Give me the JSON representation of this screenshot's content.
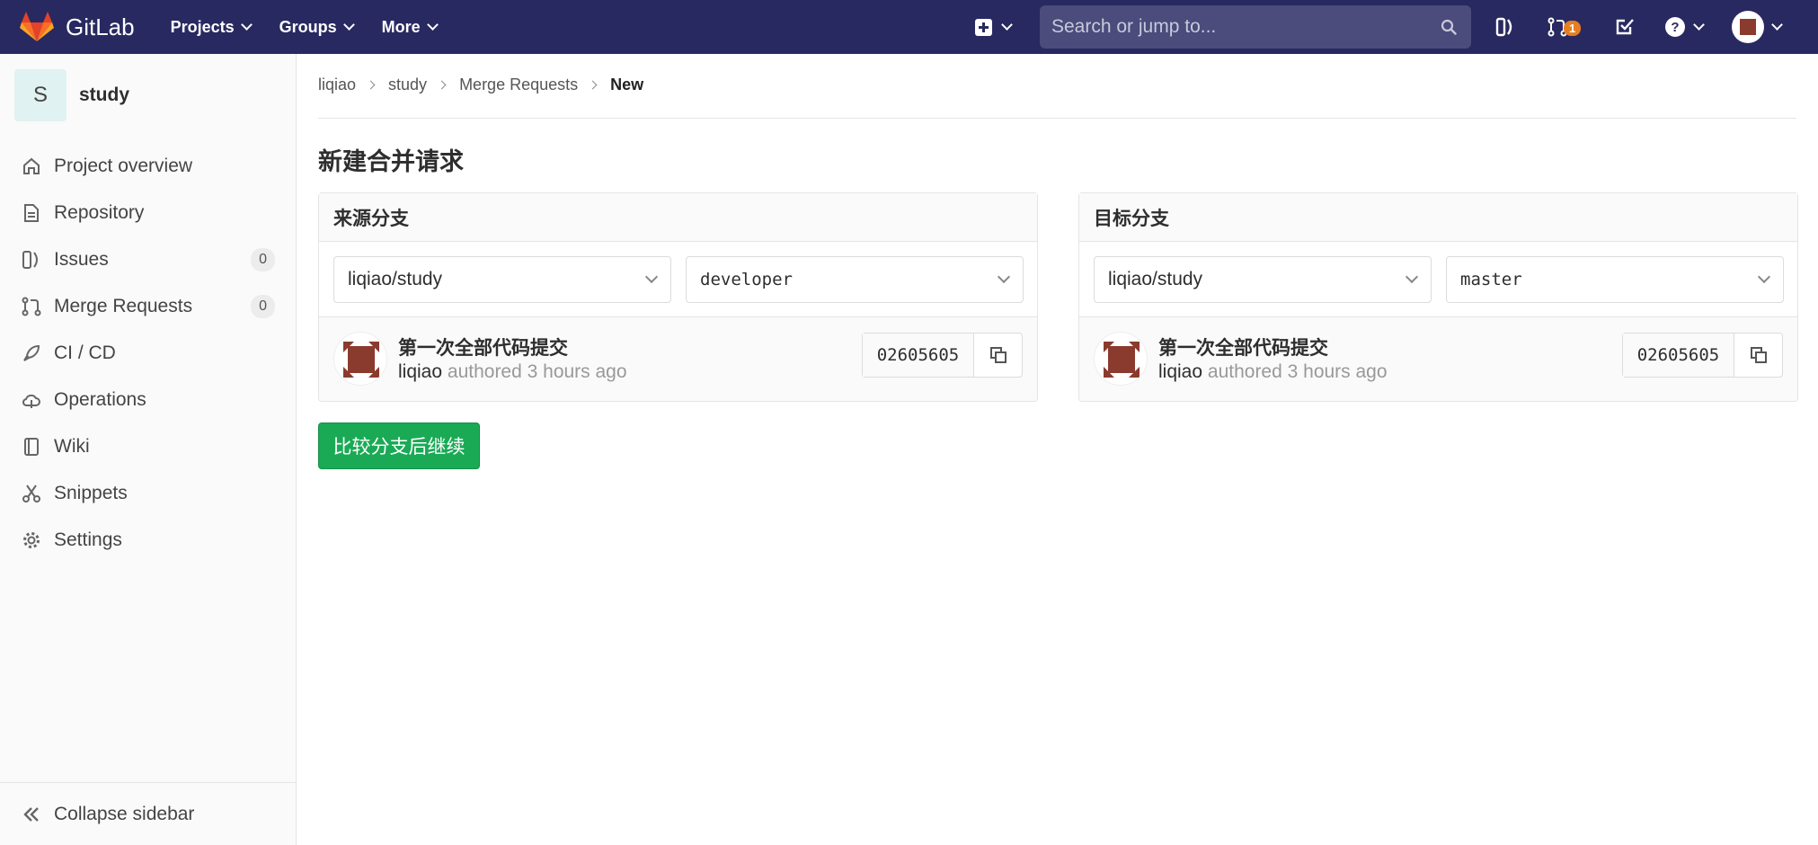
{
  "app": {
    "name": "GitLab",
    "colors": {
      "navbar": "#292961",
      "accent": "#1aaa55",
      "badge": "#e67e22"
    }
  },
  "navbar": {
    "menus": [
      "Projects",
      "Groups",
      "More"
    ],
    "search_placeholder": "Search or jump to...",
    "merge_request_badge": "1",
    "icons": [
      "plus-square-icon",
      "search-icon",
      "issues-icon",
      "merge-request-icon",
      "todo-icon",
      "help-icon",
      "user-avatar"
    ]
  },
  "sidebar": {
    "project_initial": "S",
    "project_name": "study",
    "items": [
      {
        "label": "Project overview",
        "icon": "home-icon"
      },
      {
        "label": "Repository",
        "icon": "document-icon"
      },
      {
        "label": "Issues",
        "icon": "issues-icon",
        "count": "0"
      },
      {
        "label": "Merge Requests",
        "icon": "merge-request-icon",
        "count": "0"
      },
      {
        "label": "CI / CD",
        "icon": "rocket-icon"
      },
      {
        "label": "Operations",
        "icon": "cloud-icon"
      },
      {
        "label": "Wiki",
        "icon": "book-icon"
      },
      {
        "label": "Snippets",
        "icon": "scissors-icon"
      },
      {
        "label": "Settings",
        "icon": "gear-icon"
      }
    ],
    "collapse_label": "Collapse sidebar"
  },
  "breadcrumb": [
    "liqiao",
    "study",
    "Merge Requests",
    "New"
  ],
  "page": {
    "title": "新建合并请求",
    "source": {
      "heading": "来源分支",
      "project": "liqiao/study",
      "branch": "developer",
      "commit_title": "第一次全部代码提交",
      "author": "liqiao",
      "meta": "authored 3 hours ago",
      "sha": "02605605"
    },
    "target": {
      "heading": "目标分支",
      "project": "liqiao/study",
      "branch": "master",
      "commit_title": "第一次全部代码提交",
      "author": "liqiao",
      "meta": "authored 3 hours ago",
      "sha": "02605605"
    },
    "submit_label": "比较分支后继续"
  }
}
